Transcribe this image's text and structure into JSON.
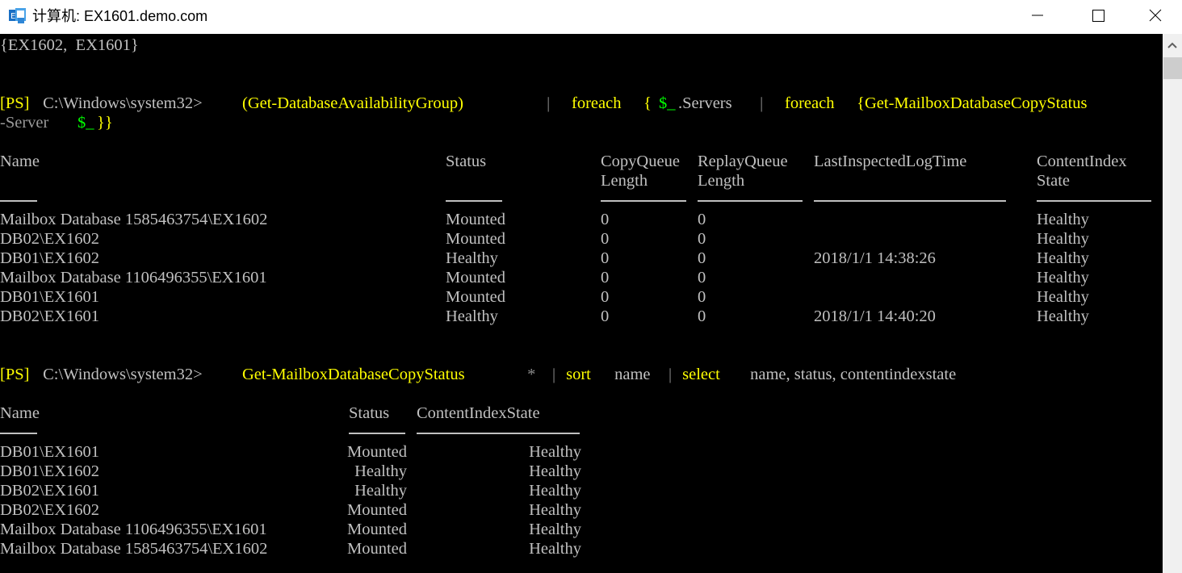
{
  "window": {
    "title": "计算机: EX1601.demo.com",
    "icon": "remote-desktop-icon",
    "controls": {
      "minimize": "minimize-icon",
      "maximize": "maximize-icon",
      "close": "close-icon"
    }
  },
  "console": {
    "first_line": "{EX1602,  EX1601}",
    "command1": {
      "prompt_tag": "[PS]",
      "path": " C:\\Windows\\system32>",
      "part1": "(Get-DatabaseAvailabilityGroup)",
      "pipe": " | ",
      "foreach1": "foreach",
      "brace1": " {",
      "var1": "$_",
      "servers": ".Servers",
      "pipe2": " | ",
      "foreach2": "foreach",
      "brace2": " {Get-MailboxDatabaseCopyStatus",
      "server_param": "-Server ",
      "var2": "$_",
      "close_braces": "}}"
    },
    "table1": {
      "headers": {
        "name": "Name",
        "status": "Status",
        "copyqueue_1": "CopyQueue",
        "copyqueue_2": "Length",
        "replayqueue_1": "ReplayQueue",
        "replayqueue_2": "Length",
        "lastinspected": "LastInspectedLogTime",
        "contentindex_1": "ContentIndex",
        "contentindex_2": "State"
      },
      "rows": [
        {
          "name": "Mailbox Database 1585463754\\EX1602",
          "status": "Mounted",
          "copyqueue": "0",
          "replayqueue": "0",
          "lastinspected": "",
          "contentindex": "Healthy"
        },
        {
          "name": "DB02\\EX1602",
          "status": "Mounted",
          "copyqueue": "0",
          "replayqueue": "0",
          "lastinspected": "",
          "contentindex": "Healthy"
        },
        {
          "name": "DB01\\EX1602",
          "status": "Healthy",
          "copyqueue": "0",
          "replayqueue": "0",
          "lastinspected": "2018/1/1 14:38:26",
          "contentindex": "Healthy"
        },
        {
          "name": "Mailbox Database 1106496355\\EX1601",
          "status": "Mounted",
          "copyqueue": "0",
          "replayqueue": "0",
          "lastinspected": "",
          "contentindex": "Healthy"
        },
        {
          "name": "DB01\\EX1601",
          "status": "Mounted",
          "copyqueue": "0",
          "replayqueue": "0",
          "lastinspected": "",
          "contentindex": "Healthy"
        },
        {
          "name": "DB02\\EX1601",
          "status": "Healthy",
          "copyqueue": "0",
          "replayqueue": "0",
          "lastinspected": "2018/1/1 14:40:20",
          "contentindex": "Healthy"
        }
      ]
    },
    "command2": {
      "prompt_tag": "[PS]",
      "path": " C:\\Windows\\system32>",
      "cmdlet": "Get-MailboxDatabaseCopyStatus",
      "arg": " * ",
      "pipe": "|",
      "sort": " sort",
      "sort_arg": " name ",
      "pipe2": "|",
      "select": " select",
      "select_args": " name, status, contentindexstate"
    },
    "table2": {
      "headers": {
        "name": "Name",
        "status": "Status",
        "contentindex": "ContentIndexState"
      },
      "rows": [
        {
          "name": "DB01\\EX1601",
          "status": "Mounted",
          "contentindex": "Healthy"
        },
        {
          "name": "DB01\\EX1602",
          "status": "Healthy",
          "contentindex": "Healthy"
        },
        {
          "name": "DB02\\EX1601",
          "status": "Healthy",
          "contentindex": "Healthy"
        },
        {
          "name": "DB02\\EX1602",
          "status": "Mounted",
          "contentindex": "Healthy"
        },
        {
          "name": "Mailbox Database 1106496355\\EX1601",
          "status": "Mounted",
          "contentindex": "Healthy"
        },
        {
          "name": "Mailbox Database 1585463754\\EX1602",
          "status": "Mounted",
          "contentindex": "Healthy"
        }
      ]
    }
  },
  "colors": {
    "console_bg": "#000000",
    "text": "#c0c0c0",
    "keyword": "#ffff00",
    "variable": "#00ff00"
  }
}
